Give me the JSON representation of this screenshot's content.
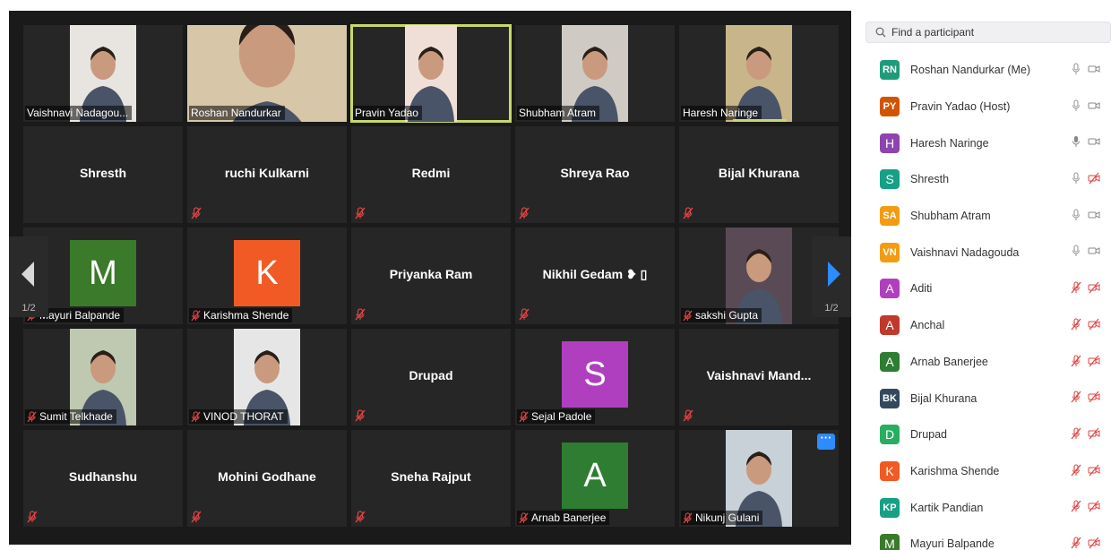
{
  "gallery": {
    "page_indicator": "1/2",
    "tiles": [
      {
        "name": "Vaishnavi Nadagou...",
        "kind": "video",
        "muted": false,
        "bg": "#e8e4e0"
      },
      {
        "name": "Roshan Nandurkar",
        "kind": "video",
        "muted": false,
        "bg": "#d7c6a8"
      },
      {
        "name": "Pravin Yadao",
        "kind": "video",
        "muted": false,
        "bg": "#f0dfd6",
        "active": true
      },
      {
        "name": "Shubham Atram",
        "kind": "video",
        "muted": false,
        "bg": "#cfcac4"
      },
      {
        "name": "Haresh Naringe",
        "kind": "video",
        "muted": false,
        "bg": "#c9b58a",
        "speaking": true
      },
      {
        "name": "Shresth",
        "kind": "name",
        "muted": false
      },
      {
        "name": "ruchi Kulkarni",
        "kind": "name",
        "muted": true
      },
      {
        "name": "Redmi",
        "kind": "name",
        "muted": true
      },
      {
        "name": "Shreya Rao",
        "kind": "name",
        "muted": true
      },
      {
        "name": "Bijal Khurana",
        "kind": "name",
        "muted": true
      },
      {
        "name": "Mayuri Balpande",
        "kind": "letter",
        "letter": "M",
        "color": "#3a7a2a",
        "muted": true
      },
      {
        "name": "Karishma Shende",
        "kind": "letter",
        "letter": "K",
        "color": "#f15a24",
        "muted": true
      },
      {
        "name": "Priyanka Ram",
        "kind": "name",
        "muted": true
      },
      {
        "name": "Nikhil  Gedam ❥ ▯",
        "kind": "name",
        "muted": true
      },
      {
        "name": "sakshi Gupta",
        "kind": "video",
        "muted": true,
        "bg": "#5a4a56"
      },
      {
        "name": "Sumit Telkhade",
        "kind": "video",
        "muted": true,
        "bg": "#bfc8b0"
      },
      {
        "name": "VINOD THORAT",
        "kind": "video",
        "muted": true,
        "bg": "#e6e6e6"
      },
      {
        "name": "Drupad",
        "kind": "name",
        "muted": true
      },
      {
        "name": "Sejal Padole",
        "kind": "letter",
        "letter": "S",
        "color": "#b03fbf",
        "muted": true
      },
      {
        "name": "Vaishnavi  Mand...",
        "kind": "name",
        "muted": true
      },
      {
        "name": "Sudhanshu",
        "kind": "name",
        "muted": true
      },
      {
        "name": "Mohini Godhane",
        "kind": "name",
        "muted": true
      },
      {
        "name": "Sneha Rajput",
        "kind": "name",
        "muted": true
      },
      {
        "name": "Arnab Banerjee",
        "kind": "letter",
        "letter": "A",
        "color": "#2e7d32",
        "muted": true
      },
      {
        "name": "Nikunj Gulani",
        "kind": "video",
        "muted": true,
        "bg": "#c8d0d8",
        "more": true
      }
    ]
  },
  "participants": {
    "search_placeholder": "Find a participant",
    "items": [
      {
        "initials": "RN",
        "color": "#1e9c7a",
        "name": "Roshan Nandurkar (Me)",
        "mic": "on",
        "video": "on"
      },
      {
        "initials": "PY",
        "color": "#d35400",
        "name": "Pravin Yadao (Host)",
        "mic": "on",
        "video": "on"
      },
      {
        "initials": "H",
        "color": "#8e44ad",
        "name": "Haresh Naringe",
        "mic": "speaking",
        "video": "on"
      },
      {
        "initials": "S",
        "color": "#16a085",
        "name": "Shresth",
        "mic": "on",
        "video": "off"
      },
      {
        "initials": "SA",
        "color": "#f39c12",
        "name": "Shubham Atram",
        "mic": "on",
        "video": "on"
      },
      {
        "initials": "VN",
        "color": "#f39c12",
        "name": "Vaishnavi Nadagouda",
        "mic": "on",
        "video": "on"
      },
      {
        "initials": "A",
        "color": "#b03fbf",
        "name": "Aditi",
        "mic": "off",
        "video": "off"
      },
      {
        "initials": "A",
        "color": "#c0392b",
        "name": "Anchal",
        "mic": "off",
        "video": "off"
      },
      {
        "initials": "A",
        "color": "#2e7d32",
        "name": "Arnab Banerjee",
        "mic": "off",
        "video": "off"
      },
      {
        "initials": "BK",
        "color": "#34495e",
        "name": "Bijal Khurana",
        "mic": "off",
        "video": "off"
      },
      {
        "initials": "D",
        "color": "#27ae60",
        "name": "Drupad",
        "mic": "off",
        "video": "off"
      },
      {
        "initials": "K",
        "color": "#f15a24",
        "name": "Karishma Shende",
        "mic": "off",
        "video": "off"
      },
      {
        "initials": "KP",
        "color": "#16a085",
        "name": "Kartik Pandian",
        "mic": "off",
        "video": "off"
      },
      {
        "initials": "M",
        "color": "#3a7a2a",
        "name": "Mayuri Balpande",
        "mic": "off",
        "video": "off"
      }
    ]
  }
}
